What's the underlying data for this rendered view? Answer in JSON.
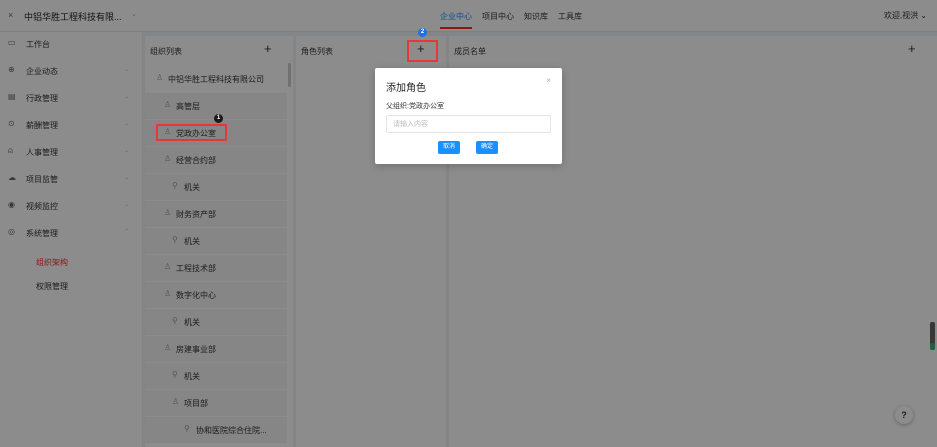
{
  "topbar": {
    "close_glyph": "×",
    "company": "中铝华胜工程科技有限...",
    "company_caret": "⌄",
    "nav": [
      "企业中心",
      "项目中心",
      "知识库",
      "工具库"
    ],
    "user": "欢迎,视洪 ⌄"
  },
  "sidebar": {
    "items": [
      {
        "label": "工作台",
        "icon": "▭"
      },
      {
        "label": "企业动态",
        "icon": "⊕"
      },
      {
        "label": "行政管理",
        "icon": "▤"
      },
      {
        "label": "薪酬管理",
        "icon": "⊙"
      },
      {
        "label": "人事管理",
        "icon": "⍝"
      },
      {
        "label": "项目监管",
        "icon": "☁"
      },
      {
        "label": "视频监控",
        "icon": "◉"
      },
      {
        "label": "系统管理",
        "icon": "◎"
      }
    ],
    "caret_down": "⌄",
    "caret_up": "⌃",
    "sub": [
      "组织架构",
      "权限管理"
    ]
  },
  "org_panel": {
    "title": "组织列表",
    "add": "+",
    "root": "中铝华胜工程科技有限公司",
    "nodes": [
      "高管层",
      "党政办公室",
      "经营合约部",
      "机关",
      "财务资产部",
      "机关",
      "工程技术部",
      "数字化中心",
      "机关",
      "房建事业部",
      "机关",
      "项目部",
      "协和医院综合住院..."
    ],
    "icon_org": "♙",
    "icon_key": "⚲"
  },
  "role_panel": {
    "title": "角色列表",
    "add": "+"
  },
  "member_panel": {
    "title": "成员名单",
    "add": "+"
  },
  "dialog": {
    "title": "添加角色",
    "close": "×",
    "parent_label": "父组织:党政办公室",
    "input_placeholder": "请输入内容",
    "input_value": "",
    "cancel": "取消",
    "confirm": "确定"
  },
  "badges": {
    "one": "1",
    "two": "2"
  },
  "help": "?",
  "colors": {
    "accent": "#1890ff",
    "highlight": "#e53935",
    "active_menu": "#ff2b2b"
  }
}
